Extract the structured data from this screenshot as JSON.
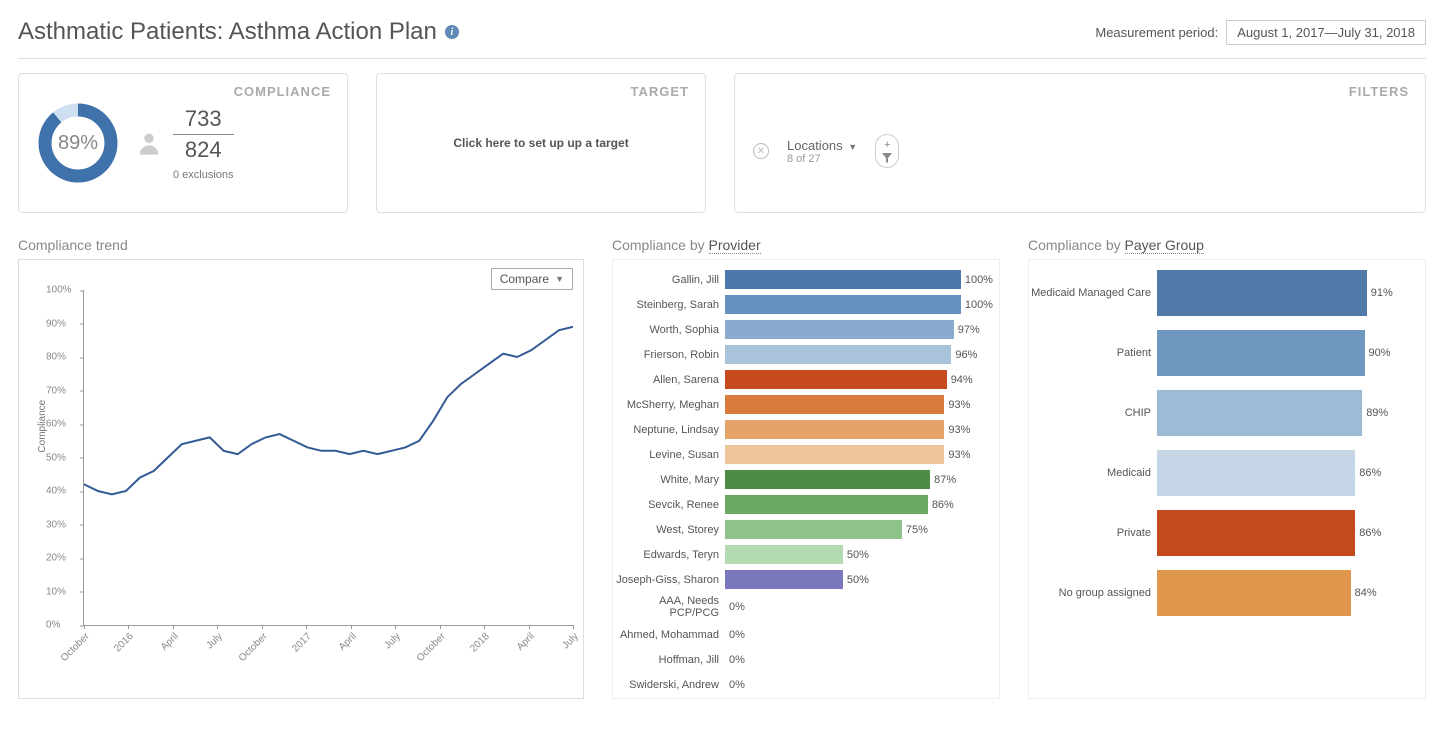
{
  "header": {
    "title": "Asthmatic Patients: Asthma Action Plan",
    "period_label": "Measurement period:",
    "period_value": "August 1, 2017—July 31, 2018"
  },
  "cards": {
    "compliance_label": "COMPLIANCE",
    "target_label": "TARGET",
    "filters_label": "FILTERS",
    "donut_pct_text": "89%",
    "donut_pct": 89,
    "numerator": "733",
    "denominator": "824",
    "exclusions": "0 exclusions",
    "target_link": "Click here to set up up a target",
    "filters": {
      "locations_label": "Locations",
      "locations_sub": "8 of 27",
      "add": "+",
      "funnel": "▾"
    }
  },
  "trend": {
    "title": "Compliance trend",
    "compare_label": "Compare",
    "ylabel": "Compliance"
  },
  "provider": {
    "title_prefix": "Compliance by ",
    "title_dd": "Provider"
  },
  "payer": {
    "title_prefix": "Compliance by ",
    "title_dd": "Payer Group"
  },
  "chart_data": [
    {
      "type": "line",
      "title": "Compliance trend",
      "ylabel": "Compliance",
      "ylim": [
        0,
        100
      ],
      "yticks": [
        0,
        10,
        20,
        30,
        40,
        50,
        60,
        70,
        80,
        90,
        100
      ],
      "categories": [
        "October",
        "2016",
        "April",
        "July",
        "October",
        "2017",
        "April",
        "July",
        "October",
        "2018",
        "April",
        "July"
      ],
      "values": [
        42,
        40,
        39,
        40,
        44,
        46,
        50,
        54,
        55,
        56,
        52,
        51,
        54,
        56,
        57,
        55,
        53,
        52,
        52,
        51,
        52,
        51,
        52,
        53,
        55,
        61,
        68,
        72,
        75,
        78,
        81,
        80,
        82,
        85,
        88,
        89
      ]
    },
    {
      "type": "bar",
      "title": "Compliance by Provider",
      "xlabel": "",
      "ylabel": "",
      "categories": [
        "Gallin, Jill",
        "Steinberg, Sarah",
        "Worth, Sophia",
        "Frierson, Robin",
        "Allen, Sarena",
        "McSherry, Meghan",
        "Neptune, Lindsay",
        "Levine, Susan",
        "White, Mary",
        "Sevcik, Renee",
        "West, Storey",
        "Edwards, Teryn",
        "Joseph-Giss, Sharon",
        "AAA, Needs PCP/PCG",
        "Ahmed, Mohammad",
        "Hoffman, Jill",
        "Swiderski, Andrew"
      ],
      "values": [
        100,
        100,
        97,
        96,
        94,
        93,
        93,
        93,
        87,
        86,
        75,
        50,
        50,
        0,
        0,
        0,
        0
      ],
      "colors": [
        "#4b78ad",
        "#6791bf",
        "#89acce",
        "#a8c3da",
        "#c64a1d",
        "#d97b3d",
        "#e4a368",
        "#edc79b",
        "#4c8c46",
        "#6ba864",
        "#8fc389",
        "#b3dab0",
        "#7b77bd",
        "",
        "",
        "",
        ""
      ]
    },
    {
      "type": "bar",
      "title": "Compliance by Payer Group",
      "categories": [
        "Medicaid Managed Care",
        "Patient",
        "CHIP",
        "Medicaid",
        "Private",
        "No group assigned"
      ],
      "values": [
        91,
        90,
        89,
        86,
        86,
        84
      ],
      "colors": [
        "#5079a8",
        "#6f97c0",
        "#9ebbd6",
        "#c4d5e6",
        "#c24a1e",
        "#e0974e"
      ]
    }
  ]
}
